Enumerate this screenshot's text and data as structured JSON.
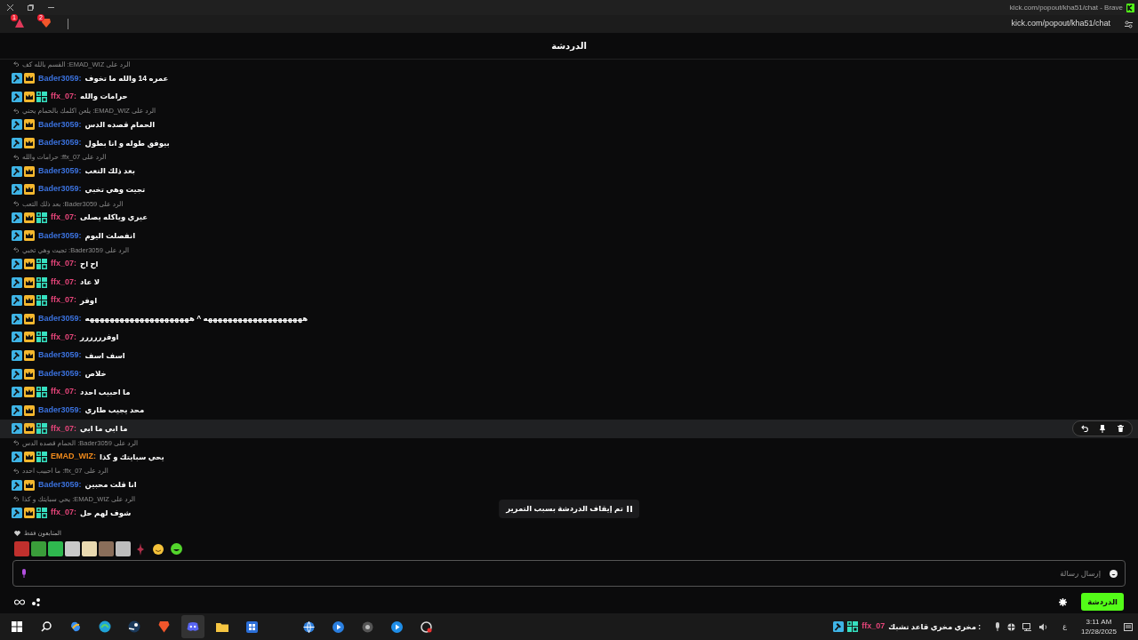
{
  "browser": {
    "title": "kick.com/popout/kha51/chat - Brave",
    "address": "kick.com/popout/kha51/chat",
    "extension_badge": "1",
    "shields_badge": "2"
  },
  "header": {
    "title": "الدردشة"
  },
  "messages": [
    {
      "reply": "الرد على EMAD_WIZ: القسم بالله كف",
      "user": "Bader3059:",
      "color": "#3b72de",
      "badges": [
        {
          "kind": "mod"
        },
        {
          "kind": "crown"
        }
      ],
      "text": "عمره 14 والله ما تخوف",
      "hovered": false
    },
    {
      "user": "ffx_07:",
      "color": "#e6457a",
      "badges": [
        {
          "kind": "mod"
        },
        {
          "kind": "crown"
        },
        {
          "kind": "og"
        }
      ],
      "text": "حرامات والله",
      "hovered": false
    },
    {
      "reply": "الرد على EMAD_WIZ: يلعن اكلمك بالحمام يحني",
      "user": "Bader3059:",
      "color": "#3b72de",
      "badges": [
        {
          "kind": "mod"
        },
        {
          "kind": "crown"
        }
      ],
      "text": "الحمام قصده الدس",
      "hovered": false
    },
    {
      "user": "Bader3059:",
      "color": "#3b72de",
      "badges": [
        {
          "kind": "mod"
        },
        {
          "kind": "crown"
        }
      ],
      "text": "بيوفق طوله و انا بطول",
      "hovered": false
    },
    {
      "reply": "الرد على ffx_07: حرامات والله",
      "user": "Bader3059:",
      "color": "#3b72de",
      "badges": [
        {
          "kind": "mod"
        },
        {
          "kind": "crown"
        }
      ],
      "text": "بعد ذلك التعب",
      "hovered": false
    },
    {
      "user": "Bader3059:",
      "color": "#3b72de",
      "badges": [
        {
          "kind": "mod"
        },
        {
          "kind": "crown"
        }
      ],
      "text": "تجيت وهي تخبي",
      "hovered": false
    },
    {
      "reply": "الرد على Bader3059: بعد ذلك التعب",
      "user": "ffx_07:",
      "color": "#e6457a",
      "badges": [
        {
          "kind": "mod"
        },
        {
          "kind": "crown"
        },
        {
          "kind": "og"
        }
      ],
      "text": "عيري وياكله يصلى",
      "hovered": false
    },
    {
      "user": "Bader3059:",
      "color": "#3b72de",
      "badges": [
        {
          "kind": "mod"
        },
        {
          "kind": "crown"
        }
      ],
      "text": "انفصلت اليوم",
      "hovered": false
    },
    {
      "reply": "الرد على Bader3059: تجيت وهي تخبي",
      "user": "ffx_07:",
      "color": "#e6457a",
      "badges": [
        {
          "kind": "mod"
        },
        {
          "kind": "crown"
        },
        {
          "kind": "og"
        }
      ],
      "text": "اح اح",
      "hovered": false
    },
    {
      "user": "ffx_07:",
      "color": "#e6457a",
      "badges": [
        {
          "kind": "mod"
        },
        {
          "kind": "crown"
        },
        {
          "kind": "og"
        }
      ],
      "text": "لا عاد",
      "hovered": false
    },
    {
      "user": "ffx_07:",
      "color": "#e6457a",
      "badges": [
        {
          "kind": "mod"
        },
        {
          "kind": "crown"
        },
        {
          "kind": "og"
        }
      ],
      "text": "اوفر",
      "hovered": false
    },
    {
      "user": "Bader3059:",
      "color": "#3b72de",
      "badges": [
        {
          "kind": "mod"
        },
        {
          "kind": "crown"
        }
      ],
      "text": "ههههههههههههههههههههه ^ هههههههههههههههههههههه",
      "hovered": false
    },
    {
      "user": "ffx_07:",
      "color": "#e6457a",
      "badges": [
        {
          "kind": "mod"
        },
        {
          "kind": "crown"
        },
        {
          "kind": "og"
        }
      ],
      "text": "اوفرررررر",
      "hovered": false
    },
    {
      "user": "Bader3059:",
      "color": "#3b72de",
      "badges": [
        {
          "kind": "mod"
        },
        {
          "kind": "crown"
        }
      ],
      "text": "اسف اسف",
      "hovered": false
    },
    {
      "user": "Bader3059:",
      "color": "#3b72de",
      "badges": [
        {
          "kind": "mod"
        },
        {
          "kind": "crown"
        }
      ],
      "text": "خلاص",
      "hovered": false
    },
    {
      "user": "ffx_07:",
      "color": "#e6457a",
      "badges": [
        {
          "kind": "mod"
        },
        {
          "kind": "crown"
        },
        {
          "kind": "og"
        }
      ],
      "text": "ما احبيب احدد",
      "hovered": false
    },
    {
      "user": "Bader3059:",
      "color": "#3b72de",
      "badges": [
        {
          "kind": "mod"
        },
        {
          "kind": "crown"
        }
      ],
      "text": "محد يجيب طاري",
      "hovered": false
    },
    {
      "user": "ffx_07:",
      "color": "#e6457a",
      "badges": [
        {
          "kind": "mod"
        },
        {
          "kind": "crown"
        },
        {
          "kind": "og"
        }
      ],
      "text": "ما ابي ما ابي",
      "hovered": true
    },
    {
      "reply": "الرد على Bader3059: الحمام قصده الدس",
      "user": "EMAD_WIZ:",
      "color": "#f28b1b",
      "badges": [
        {
          "kind": "mod"
        },
        {
          "kind": "crown"
        },
        {
          "kind": "og"
        }
      ],
      "text": "يحي سبايتك و كذا",
      "hovered": false
    },
    {
      "reply": "الرد على ffx_07: ما احبيب احدد",
      "user": "Bader3059:",
      "color": "#3b72de",
      "badges": [
        {
          "kind": "mod"
        },
        {
          "kind": "crown"
        }
      ],
      "text": "انا قلت محبين",
      "hovered": false
    },
    {
      "reply": "الرد على EMAD_WIZ: يحي سبايتك و كذا",
      "user": "ffx_07:",
      "color": "#e6457a",
      "badges": [
        {
          "kind": "mod"
        },
        {
          "kind": "crown"
        },
        {
          "kind": "og"
        }
      ],
      "text": "شوف لهم حل",
      "hovered": false
    }
  ],
  "pause_notice": "تم إيقاف الدردشة بسبب التمرير",
  "followers_label": "المتابعون فقط",
  "composer": {
    "placeholder": "إرسال رسالة"
  },
  "chat_button": "الدردشة",
  "taskbar": {
    "apps": [
      {
        "selected": false
      },
      {
        "selected": false
      },
      {
        "selected": false
      },
      {
        "selected": false
      },
      {
        "selected": false
      },
      {
        "selected": false
      },
      {
        "selected": true
      },
      {
        "selected": false
      },
      {
        "selected": false
      },
      {
        "selected": false
      },
      {
        "selected": false
      },
      {
        "selected": false
      },
      {
        "selected": false
      },
      {
        "selected": false
      }
    ],
    "notification": {
      "user": "ffx_07",
      "text": ": مخري مخري قاعد تشبك"
    },
    "language": "ع",
    "time": "3:11 AM",
    "date": "12/28/2025"
  }
}
